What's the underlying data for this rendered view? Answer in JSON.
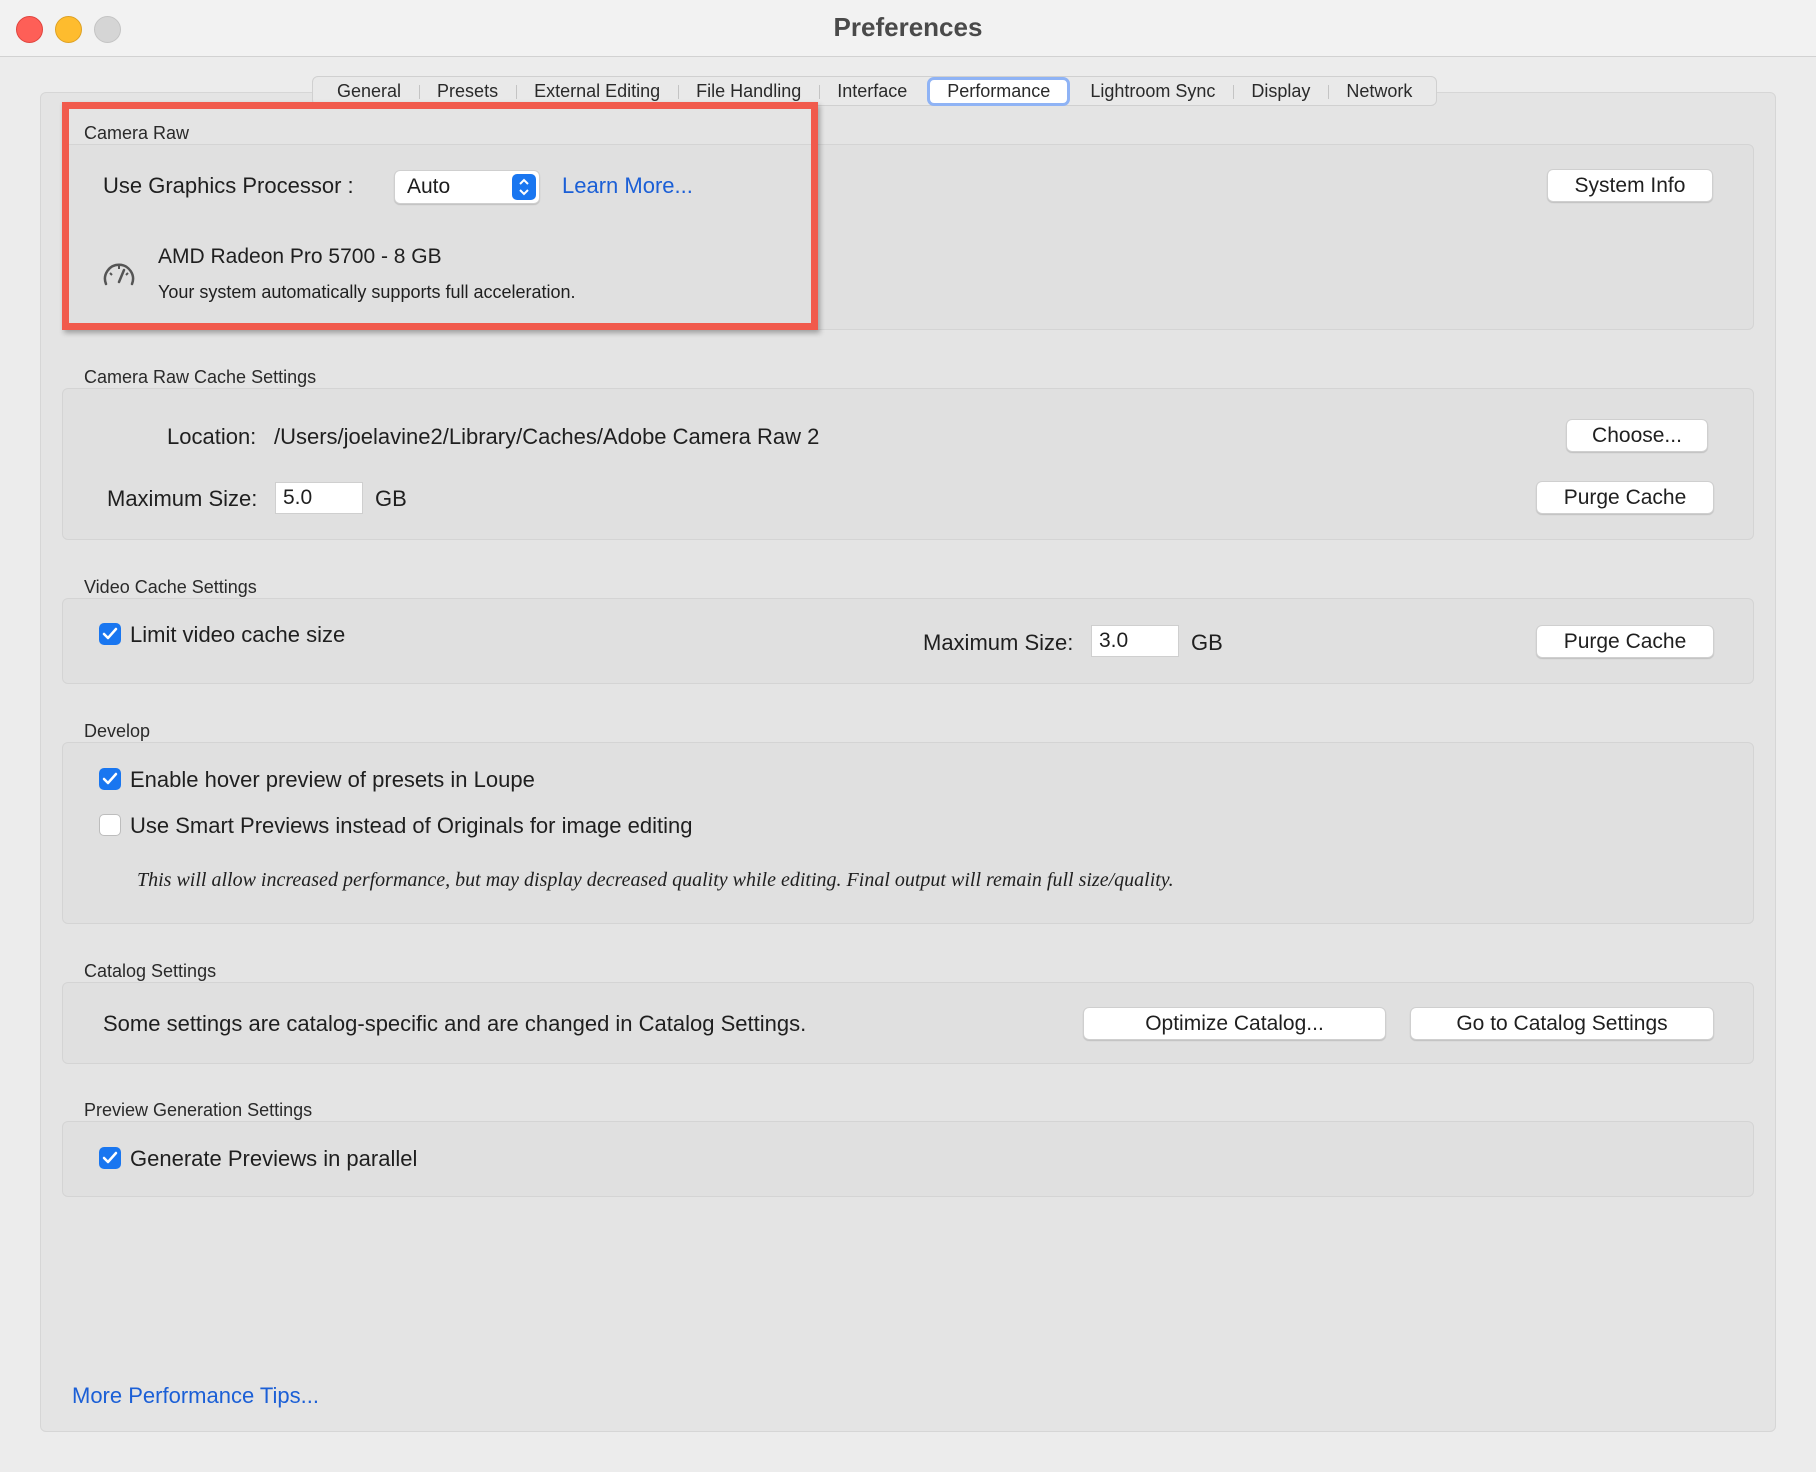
{
  "window": {
    "title": "Preferences"
  },
  "tabs": [
    "General",
    "Presets",
    "External Editing",
    "File Handling",
    "Interface",
    "Performance",
    "Lightroom Sync",
    "Display",
    "Network"
  ],
  "active_tab": "Performance",
  "camera_raw": {
    "title": "Camera Raw",
    "gpu_label": "Use Graphics Processor :",
    "gpu_value": "Auto",
    "learn_more": "Learn More...",
    "system_info": "System Info",
    "gpu_name": "AMD Radeon Pro 5700 - 8 GB",
    "gpu_status": "Your system automatically supports full acceleration."
  },
  "cache": {
    "title": "Camera Raw Cache Settings",
    "location_label": "Location:",
    "location_value": "/Users/joelavine2/Library/Caches/Adobe Camera Raw 2",
    "choose": "Choose...",
    "max_label": "Maximum Size:",
    "max_value": "5.0",
    "unit": "GB",
    "purge": "Purge Cache"
  },
  "video": {
    "title": "Video Cache Settings",
    "limit_label": "Limit video cache size",
    "limit_checked": true,
    "max_label": "Maximum Size:",
    "max_value": "3.0",
    "unit": "GB",
    "purge": "Purge Cache"
  },
  "develop": {
    "title": "Develop",
    "hover_label": "Enable hover preview of presets in Loupe",
    "hover_checked": true,
    "smart_label": "Use Smart Previews instead of Originals for image editing",
    "smart_checked": false,
    "note": "This will allow increased performance, but may display decreased quality while editing. Final output will remain full size/quality."
  },
  "catalog": {
    "title": "Catalog Settings",
    "text": "Some settings are catalog-specific and are changed in Catalog Settings.",
    "optimize": "Optimize Catalog...",
    "goto": "Go to Catalog Settings"
  },
  "preview": {
    "title": "Preview Generation Settings",
    "parallel_label": "Generate Previews in parallel",
    "parallel_checked": true
  },
  "footer_link": "More Performance Tips...",
  "colors": {
    "accent": "#1976f0",
    "link": "#1b5fd6",
    "highlight": "#f15a4c"
  }
}
